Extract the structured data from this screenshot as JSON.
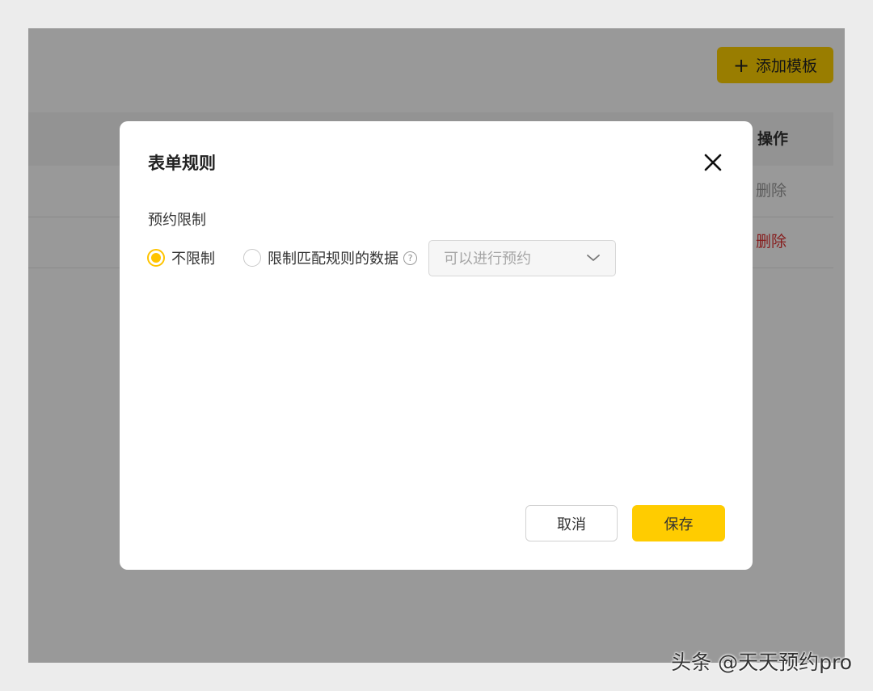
{
  "toolbar": {
    "add_template_label": "添加模板"
  },
  "table": {
    "header_ops": "操作",
    "rows": [
      {
        "action": "删除"
      },
      {
        "action": "删除"
      }
    ]
  },
  "modal": {
    "title": "表单规则",
    "section_label": "预约限制",
    "options": [
      {
        "label": "不限制",
        "checked": true
      },
      {
        "label": "限制匹配规则的数据",
        "checked": false
      }
    ],
    "select": {
      "value": "可以进行预约"
    },
    "cancel_label": "取消",
    "save_label": "保存"
  },
  "watermark": "头条 @天天预约pro",
  "colors": {
    "accent": "#ffcc00",
    "danger": "#e03131"
  }
}
